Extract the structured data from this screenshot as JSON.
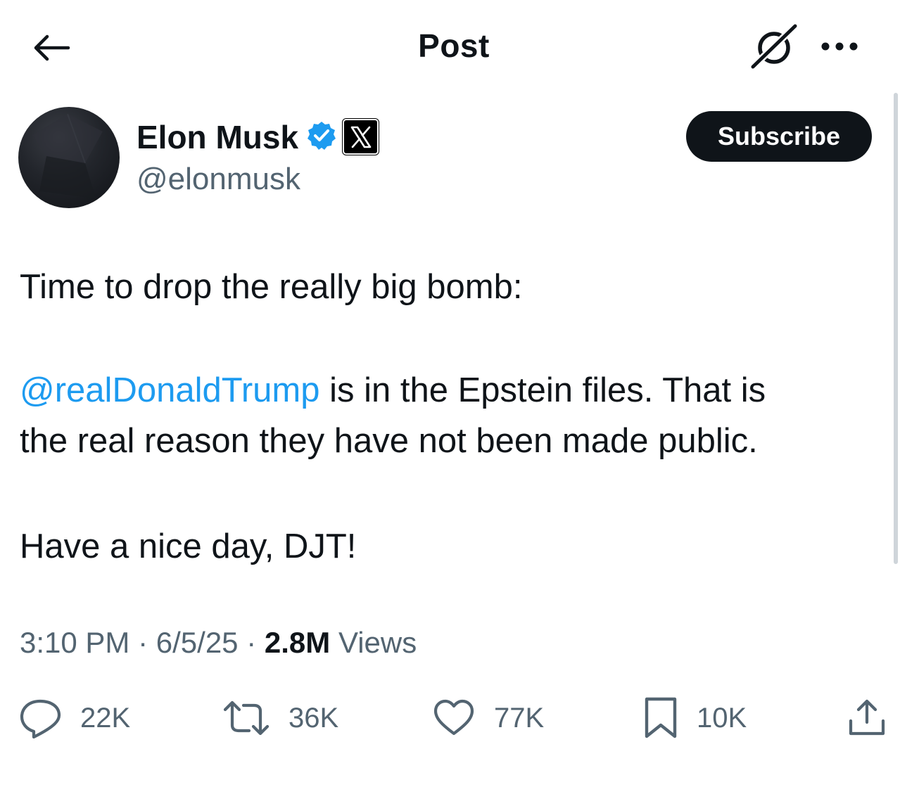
{
  "header": {
    "title": "Post",
    "back_icon": "arrow-left-icon",
    "grok_icon": "grok-icon",
    "more_icon": "more-horizontal-icon"
  },
  "author": {
    "display_name": "Elon Musk",
    "handle": "@elonmusk",
    "verified_icon": "verified-badge-icon",
    "affiliation_icon": "x-logo-icon",
    "verified_color": "#1d9bf0"
  },
  "subscribe_label": "Subscribe",
  "tweet": {
    "line1": "Time to drop the really big bomb:",
    "mention": "@realDonaldTrump",
    "line2_rest": " is in the Epstein files. That is",
    "line3": "the real reason they have not been made public.",
    "line4": "Have a nice day, DJT!"
  },
  "meta": {
    "time": "3:10 PM",
    "separator": "·",
    "date": "6/5/25",
    "views_count": "2.8M",
    "views_label": "Views"
  },
  "actions": {
    "replies": "22K",
    "reposts": "36K",
    "likes": "77K",
    "bookmarks": "10K"
  },
  "colors": {
    "text": "#0f1419",
    "secondary": "#536471",
    "link": "#1d9bf0",
    "button_bg": "#0f1419"
  }
}
